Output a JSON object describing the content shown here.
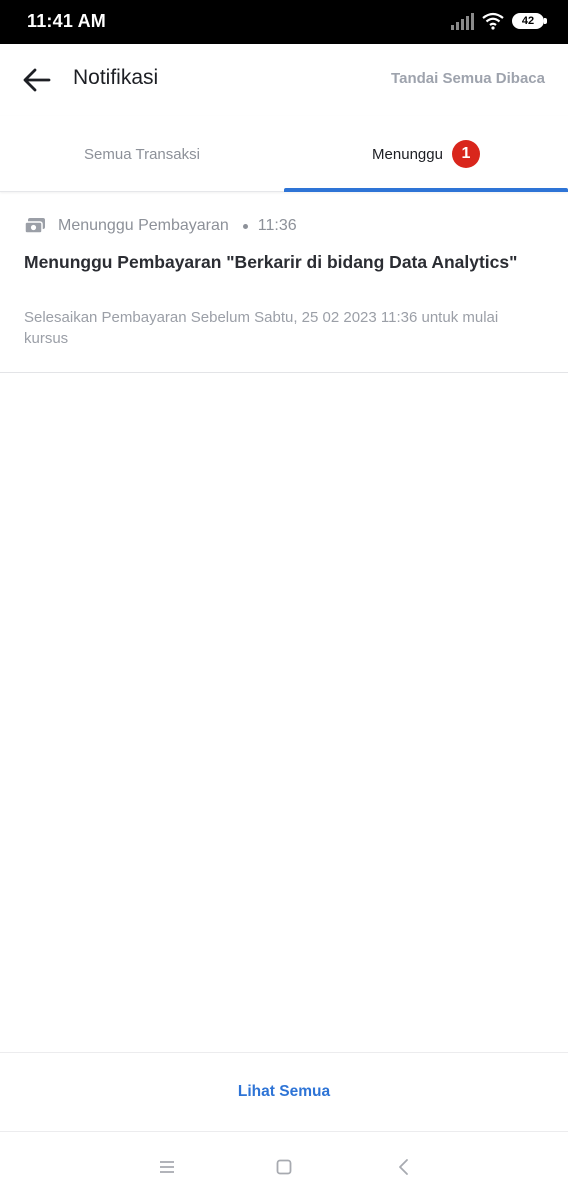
{
  "status_bar": {
    "time": "11:41 AM",
    "battery": "42",
    "icons": [
      "signal-icon",
      "wifi-icon",
      "battery-icon"
    ]
  },
  "app_bar": {
    "back_icon": "arrow-left-icon",
    "title": "Notifikasi",
    "mark_all_read": "Tandai Semua Dibaca"
  },
  "tabs": [
    {
      "label": "Semua Transaksi",
      "active": false
    },
    {
      "label": "Menunggu",
      "active": true,
      "badge": "1"
    }
  ],
  "notifications": [
    {
      "icon": "money-icon",
      "category": "Menunggu Pembayaran",
      "time": "11:36",
      "title": "Menunggu Pembayaran \"Berkarir di bidang Data Analytics\"",
      "description": "Selesaikan Pembayaran Sebelum Sabtu, 25 02 2023 11:36 untuk mulai kursus"
    }
  ],
  "footer": {
    "see_all": "Lihat Semua"
  },
  "nav_bar": {
    "icons": [
      "menu-icon",
      "home-icon",
      "back-icon"
    ]
  },
  "colors": {
    "accent": "#2e74d6",
    "badge": "#d9261c",
    "muted_text": "#9ea3ad"
  }
}
